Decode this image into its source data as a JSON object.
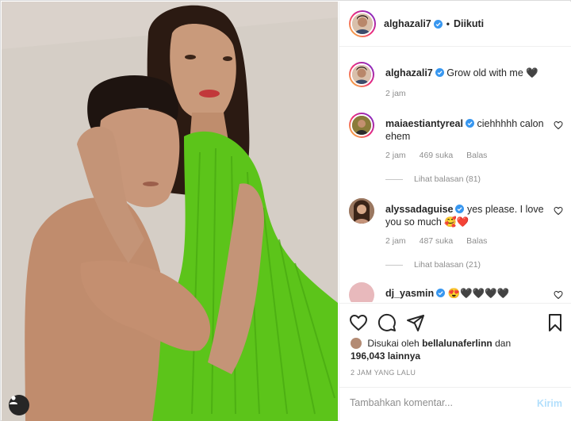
{
  "post": {
    "author": "alghazali7",
    "follow_status": "Diikuti",
    "dot": "•"
  },
  "caption": {
    "username": "alghazali7",
    "text": "Grow old with me 🖤",
    "time": "2 jam"
  },
  "comments": [
    {
      "username": "maiaestiantyreal",
      "text": "ciehhhhh calon ehem",
      "time": "2 jam",
      "likes": "469 suka",
      "reply_label": "Balas",
      "view_replies": "Lihat balasan (81)"
    },
    {
      "username": "alyssadaguise",
      "text": "yes please. I love you so much 🥰❤️",
      "time": "2 jam",
      "likes": "487 suka",
      "reply_label": "Balas",
      "view_replies": "Lihat balasan (21)"
    },
    {
      "username": "dj_yasmin",
      "text": "😍🖤🖤🖤🖤"
    }
  ],
  "likes": {
    "prefix": "Disukai oleh",
    "liked_by": "bellalunaferlinn",
    "conj": "dan",
    "count": "196,043 lainnya"
  },
  "timestamp": "2 JAM YANG LALU",
  "comment_box": {
    "placeholder": "Tambahkan komentar...",
    "send_label": "Kirim"
  },
  "colors": {
    "verified": "#3897f0",
    "send_disabled": "#b2dffc",
    "dress": "#5cc41a"
  },
  "icons": [
    "heart-icon",
    "comment-icon",
    "share-icon",
    "bookmark-icon",
    "user-tag-icon",
    "verified-icon"
  ]
}
